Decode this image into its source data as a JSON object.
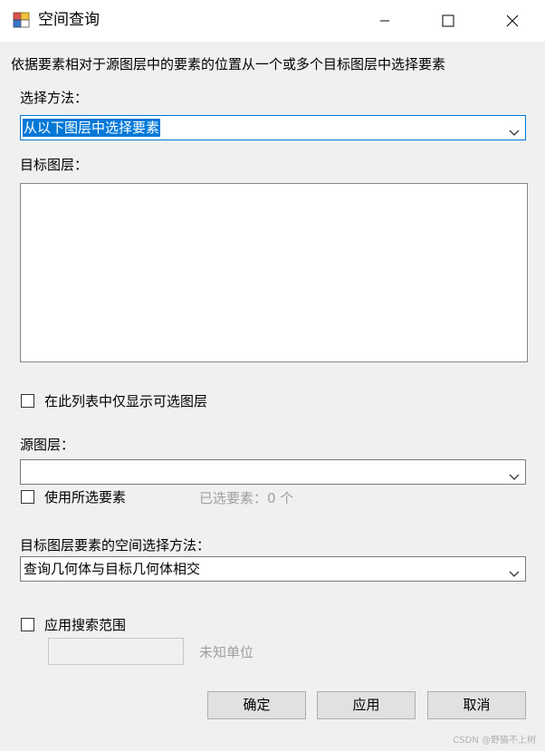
{
  "window": {
    "title": "空间查询",
    "controls": {
      "minimize": "minimize-icon",
      "maximize": "maximize-icon",
      "close": "close-icon"
    }
  },
  "description": "依据要素相对于源图层中的要素的位置从一个或多个目标图层中选择要素",
  "selection_method": {
    "label": "选择方法：",
    "value": "从以下图层中选择要素"
  },
  "target_layers": {
    "label": "目标图层：",
    "items": []
  },
  "only_selectable_checkbox": {
    "label": "在此列表中仅显示可选图层",
    "checked": false
  },
  "source_layer": {
    "label": "源图层：",
    "value": ""
  },
  "use_selected_checkbox": {
    "label": "使用所选要素",
    "checked": false
  },
  "selected_count_text": "已选要素：0 个",
  "spatial_method": {
    "label": "目标图层要素的空间选择方法：",
    "value": "查询几何体与目标几何体相交"
  },
  "search_distance_checkbox": {
    "label": "应用搜索范围",
    "checked": false
  },
  "search_distance": {
    "value": "",
    "unit": "未知单位"
  },
  "buttons": {
    "ok": "确定",
    "apply": "应用",
    "cancel": "取消"
  },
  "watermark": "CSDN @野猫不上树",
  "colors": {
    "accent": "#0078d7",
    "window_bg": "#f0f0f0",
    "disabled_text": "#a0a0a0"
  }
}
